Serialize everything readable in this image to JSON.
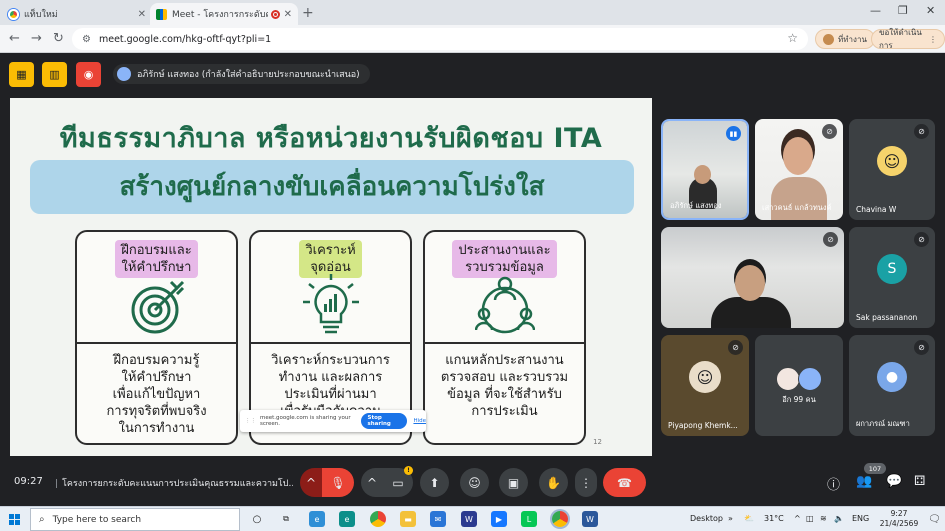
{
  "browser": {
    "tabs": [
      {
        "title": "แท็บใหม่",
        "active": false
      },
      {
        "title": "Meet - โครงการกระดับคะแนน",
        "active": true
      }
    ],
    "url": "meet.google.com/hkg-oftf-qyt?pli=1",
    "profile_label": "ที่ทำงาน",
    "update_label": "ขอให้ดำเนินการ"
  },
  "meet_header": {
    "presenter_text": "อภิรักษ์ แสงทอง (กำลังใส่คำอธิบายประกอบขณะนำเสนอ)"
  },
  "slide": {
    "title": "ทีมธรรมาภิบาล หรือหน่วยงานรับผิดชอบ ITA",
    "banner": "สร้างศูนย์กลางขับเคลื่อนความโปร่งใส",
    "page_number": "12",
    "cards": [
      {
        "heading": "ฝึกอบรมและ\nให้คำปรึกษา",
        "heading_color": "#e7b9e8",
        "icon": "target-icon",
        "body": "ฝึกอบรมความรู้\nให้คำปรึกษา\nเพื่อแก้ไขปัญหา\nการทุจริตที่พบจริง\nในการทำงาน"
      },
      {
        "heading": "วิเคราะห์\nจุดอ่อน",
        "heading_color": "#d4e787",
        "icon": "lightbulb-chart-icon",
        "body": "วิเคราะห์กระบวนการ\nทำงาน และผลการ\nประเมินที่ผ่านมา\nเพื่อรับมือกับความ"
      },
      {
        "heading": "ประสานงานและ\nรวบรวมข้อมูล",
        "heading_color": "#e7b9e8",
        "icon": "team-network-icon",
        "body": "แกนหลักประสานงาน\nตรวจสอบ และรวบรวม\nข้อมูล ที่จะใช้สำหรับ\nการประเมิน"
      }
    ]
  },
  "share_popup": {
    "message": "meet.google.com is sharing your screen.",
    "stop_label": "Stop sharing",
    "hide_label": "Hide"
  },
  "participants": [
    {
      "name": "อภิรักษ์ แสงทอง",
      "status": "speaking"
    },
    {
      "name": "เสาวคนธ์ แกล้วทนงค์",
      "status": "muted"
    },
    {
      "name": "Chavina W",
      "status": "muted"
    },
    {
      "name": "",
      "status": "muted"
    },
    {
      "name": "Sak passananon",
      "status": "muted",
      "initial": "S"
    },
    {
      "name": "Piyapong Khemk...",
      "status": "muted"
    },
    {
      "name": "อีก 99 คน",
      "status": ""
    },
    {
      "name": "ผกาภรณ์ มณฑา",
      "status": "muted"
    }
  ],
  "bottom_bar": {
    "time": "09:27",
    "meeting_title": "โครงการยกระดับคะแนนการประเมินคุณธรรมและความโป...",
    "participant_count": "107"
  },
  "taskbar": {
    "search_placeholder": "Type here to search",
    "desktop_label": "Desktop",
    "weather": "31°C",
    "language": "ENG",
    "clock_time": "9:27",
    "clock_date": "21/4/2569"
  }
}
